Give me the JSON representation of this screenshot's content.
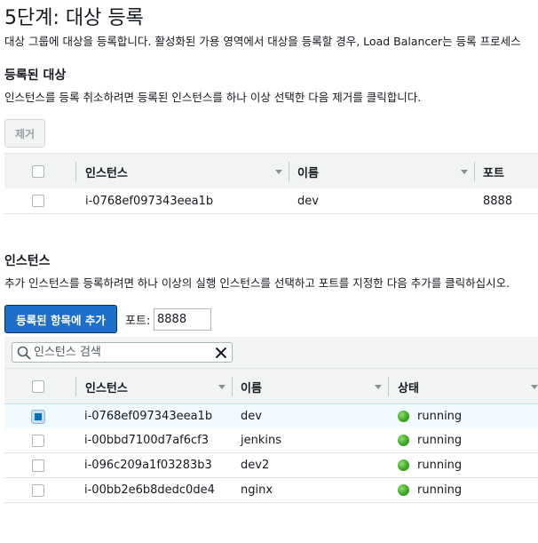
{
  "page": {
    "title": "5단계: 대상 등록",
    "description": "대상 그룹에 대상을 등록합니다. 활성화된 가용 영역에서 대상을 등록할 경우, Load Balancer는 등록 프로세스"
  },
  "registered": {
    "title": "등록된 대상",
    "description": "인스턴스를 등록 취소하려면 등록된 인스턴스를 하나 이상 선택한 다음 제거를 클릭합니다.",
    "remove_label": "제거",
    "columns": {
      "instance": "인스턴스",
      "name": "이름",
      "port": "포트"
    },
    "rows": [
      {
        "instance": "i-0768ef097343eea1b",
        "name": "dev",
        "port": "8888"
      }
    ]
  },
  "instances": {
    "title": "인스턴스",
    "description": "추가 인스턴스를 등록하려면 하나 이상의 실행 인스턴스를 선택하고 포트를 지정한 다음 추가를 클릭하십시오.",
    "add_label": "등록된 항목에 추가",
    "port_label": "포트:",
    "port_value": "8888",
    "search_placeholder": "인스턴스 검색",
    "columns": {
      "instance": "인스턴스",
      "name": "이름",
      "status": "상태"
    },
    "rows": [
      {
        "instance": "i-0768ef097343eea1b",
        "name": "dev",
        "status": "running",
        "checked": true
      },
      {
        "instance": "i-00bbd7100d7af6cf3",
        "name": "jenkins",
        "status": "running",
        "checked": false
      },
      {
        "instance": "i-096c209a1f03283b3",
        "name": "dev2",
        "status": "running",
        "checked": false
      },
      {
        "instance": "i-00bb2e6b8dedc0de4",
        "name": "nginx",
        "status": "running",
        "checked": false
      }
    ]
  },
  "colors": {
    "primary_button": "#1d6fc9",
    "status_running": "#3ea823",
    "selected_row": "#f1faff",
    "header_bg": "#f2f3f3"
  },
  "icons": {
    "search": "search-icon",
    "clear": "close-icon",
    "sort": "caret-down-icon",
    "status": "status-running-icon"
  }
}
